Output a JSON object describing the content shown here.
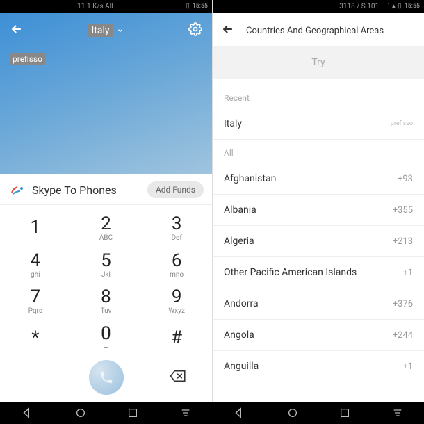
{
  "left": {
    "status": {
      "speed": "11.1 K/s All",
      "time": "15:55"
    },
    "header": {
      "country": "Italy",
      "prefix_label": "prefisso"
    },
    "skype": {
      "label": "Skype To Phones",
      "add_funds": "Add Funds"
    },
    "keys": {
      "k1": {
        "n": "1",
        "s": ""
      },
      "k2": {
        "n": "2",
        "s": "ABC"
      },
      "k3": {
        "n": "3",
        "s": "Def"
      },
      "k4": {
        "n": "4",
        "s": "ghi"
      },
      "k5": {
        "n": "5",
        "s": "Jkl"
      },
      "k6": {
        "n": "6",
        "s": "mno"
      },
      "k7": {
        "n": "7",
        "s": "Pqrs"
      },
      "k8": {
        "n": "8",
        "s": "Tuv"
      },
      "k9": {
        "n": "9",
        "s": "Wxyz"
      },
      "kstar": {
        "n": "*",
        "s": ""
      },
      "k0": {
        "n": "0",
        "s": "+"
      },
      "khash": {
        "n": "#",
        "s": ""
      }
    }
  },
  "right": {
    "status": {
      "net": "3118 / S 101",
      "time": "15:55"
    },
    "title": "Countries And Geographical Areas",
    "try": "Try",
    "recent_label": "Recent",
    "all_label": "All",
    "recent": {
      "name": "Italy",
      "code": "prefisso"
    },
    "countries": [
      {
        "name": "Afghanistan",
        "code": "+93"
      },
      {
        "name": "Albania",
        "code": "+355"
      },
      {
        "name": "Algeria",
        "code": "+213"
      },
      {
        "name": "Other Pacific American Islands",
        "code": "+1"
      },
      {
        "name": "Andorra",
        "code": "+376"
      },
      {
        "name": "Angola",
        "code": "+244"
      },
      {
        "name": "Anguilla",
        "code": "+1"
      }
    ]
  }
}
